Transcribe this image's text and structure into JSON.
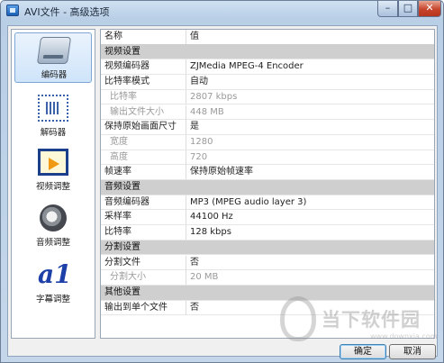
{
  "window": {
    "title": "AVI文件 - 高级选项",
    "min_label": "–",
    "max_label": "□",
    "close_label": "✕"
  },
  "sidebar": {
    "items": [
      {
        "label": "编码器",
        "icon": "encoder-icon",
        "active": true
      },
      {
        "label": "解码器",
        "icon": "decoder-icon",
        "active": false
      },
      {
        "label": "视频调整",
        "icon": "video-adjust-icon",
        "active": false
      },
      {
        "label": "音频调整",
        "icon": "audio-adjust-icon",
        "active": false
      },
      {
        "label": "字幕调整",
        "icon": "subtitle-adjust-icon",
        "active": false,
        "glyph": "a1"
      }
    ]
  },
  "table": {
    "header": {
      "name": "名称",
      "value": "值"
    },
    "rows": [
      {
        "type": "section",
        "name": "视频设置",
        "value": ""
      },
      {
        "type": "row",
        "name": "视频编码器",
        "value": "ZJMedia MPEG-4 Encoder"
      },
      {
        "type": "row",
        "name": "比特率模式",
        "value": "自动"
      },
      {
        "type": "sub",
        "name": "比特率",
        "value": "2807 kbps"
      },
      {
        "type": "sub",
        "name": "输出文件大小",
        "value": "448 MB"
      },
      {
        "type": "row",
        "name": "保持原始画面尺寸",
        "value": "是"
      },
      {
        "type": "sub",
        "name": "宽度",
        "value": "1280"
      },
      {
        "type": "sub",
        "name": "高度",
        "value": "720"
      },
      {
        "type": "row",
        "name": "帧速率",
        "value": "保持原始帧速率"
      },
      {
        "type": "section",
        "name": "音频设置",
        "value": ""
      },
      {
        "type": "row",
        "name": "音频编码器",
        "value": "MP3 (MPEG audio layer 3)"
      },
      {
        "type": "row",
        "name": "采样率",
        "value": "44100 Hz"
      },
      {
        "type": "row",
        "name": "比特率",
        "value": "128 kbps"
      },
      {
        "type": "section",
        "name": "分割设置",
        "value": ""
      },
      {
        "type": "row",
        "name": "分割文件",
        "value": "否"
      },
      {
        "type": "sub",
        "name": "分割大小",
        "value": "20 MB"
      },
      {
        "type": "section",
        "name": "其他设置",
        "value": ""
      },
      {
        "type": "row",
        "name": "输出到单个文件",
        "value": "否"
      }
    ]
  },
  "buttons": {
    "ok": "确定",
    "cancel": "取消"
  },
  "watermark": {
    "text": "当下软件园",
    "url": "www.downxia.com"
  }
}
